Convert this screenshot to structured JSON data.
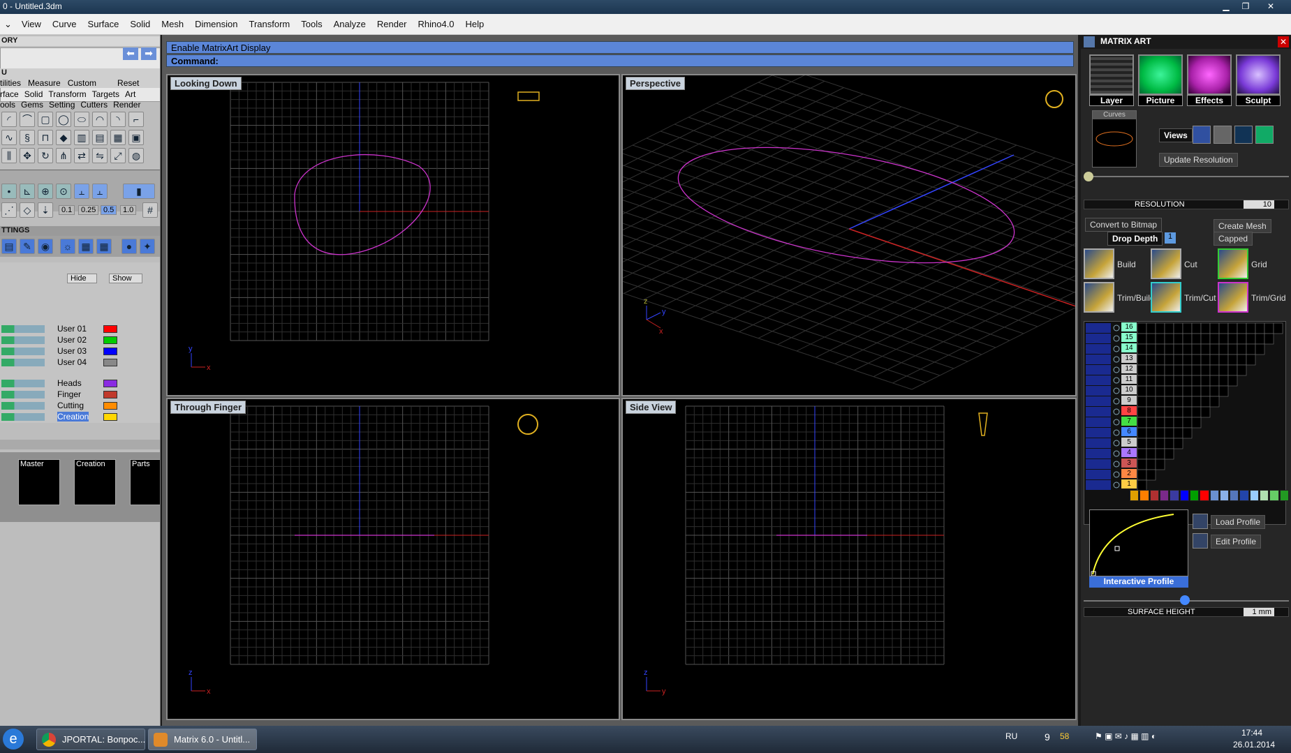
{
  "window": {
    "title": "0 - Untitled.3dm",
    "min": "▁",
    "max": "❐",
    "close": "✕"
  },
  "menu": [
    "View",
    "Curve",
    "Surface",
    "Solid",
    "Mesh",
    "Dimension",
    "Transform",
    "Tools",
    "Analyze",
    "Render",
    "Rhino4.0",
    "Help"
  ],
  "left": {
    "history": "ORY",
    "section_u": "U",
    "tabs1": [
      "tilities",
      "Measure",
      "Custom",
      "Reset"
    ],
    "tabs2": [
      "rface",
      "Solid",
      "Transform",
      "Targets",
      "Art"
    ],
    "tabs3": [
      "ools",
      "Gems",
      "Setting",
      "Cutters",
      "Render"
    ],
    "snaps": [
      "0.1",
      "0.25",
      "0.5",
      "1.0"
    ],
    "settings": "TTINGS",
    "hide": "Hide",
    "show": "Show",
    "layers": [
      {
        "name": "User 01",
        "color": "#ff0000"
      },
      {
        "name": "User 02",
        "color": "#00cc00"
      },
      {
        "name": "User 03",
        "color": "#0000ff"
      },
      {
        "name": "User 04",
        "color": "#888888"
      },
      {
        "name": "Heads",
        "color": "#8a2be2"
      },
      {
        "name": "Finger",
        "color": "#c0392b"
      },
      {
        "name": "Cutting",
        "color": "#ff8c00"
      },
      {
        "name": "Creation",
        "color": "#ffd700"
      }
    ],
    "library": [
      "Master",
      "Creation",
      "Parts"
    ]
  },
  "command": {
    "line1": "Enable MatrixArt Display",
    "label": "Command:"
  },
  "viewports": {
    "top_left": "Looking Down",
    "top_right": "Perspective",
    "bottom_left": "Through Finger",
    "bottom_right": "Side View"
  },
  "axes": {
    "x": "x",
    "y": "y",
    "z": "z"
  },
  "matrix_art": {
    "title": "MATRIX ART",
    "tabs": [
      "Layer",
      "Picture",
      "Effects",
      "Sculpt"
    ],
    "curves": "Curves",
    "views": "Views",
    "update_resolution": "Update Resolution",
    "resolution_label": "RESOLUTION",
    "resolution_value": "10",
    "convert_bitmap": "Convert to Bitmap",
    "drop_depth": "Drop Depth",
    "drop_depth_value": "1",
    "create_mesh": "Create Mesh",
    "capped": "Capped",
    "tools": [
      "Build",
      "Cut",
      "Grid",
      "Trim/Build",
      "Trim/Cut",
      "Trim/Grid"
    ],
    "layer_numbers": [
      "16",
      "15",
      "14",
      "13",
      "12",
      "11",
      "10",
      "9",
      "8",
      "7",
      "6",
      "5",
      "4",
      "3",
      "2",
      "1"
    ],
    "load_profile": "Load Profile",
    "edit_profile": "Edit Profile",
    "interactive_profile": "Interactive Profile",
    "surface_height_label": "SURFACE HEIGHT",
    "surface_height_value": "1 mm",
    "palette": [
      "#e0a000",
      "#ff7f00",
      "#b03030",
      "#7a2a8a",
      "#3a3aa0",
      "#0000ff",
      "#00a000",
      "#ff0000",
      "#6a90d0",
      "#8ab0e8",
      "#5577bb",
      "#2244aa",
      "#99ccff",
      "#b0e0b0",
      "#66cc66",
      "#229922"
    ]
  },
  "taskbar": {
    "tasks": [
      "JPORTAL: Вопрос...",
      "Matrix 6.0 - Untitl..."
    ],
    "lang": "RU",
    "tray_nums": [
      "9",
      "58"
    ],
    "time": "17:44",
    "date": "26.01.2014"
  }
}
